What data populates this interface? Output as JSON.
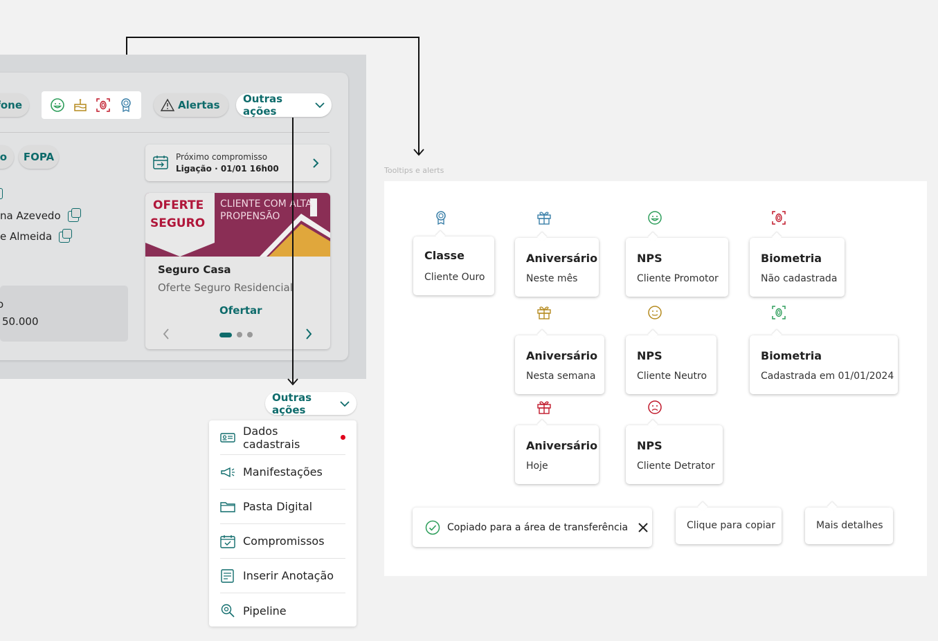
{
  "toolbar": {
    "phone_label": "fone",
    "alerts_label": "Alertas",
    "outras_acoes_label": "Outras ações"
  },
  "tags": [
    "o",
    "FOPA"
  ],
  "left_rows": {
    "row1": "na Azevedo",
    "row2": "e Almeida",
    "box_line1": "o",
    "box_line2": "50.000"
  },
  "appointment": {
    "title": "Próximo compromisso",
    "detail": "Ligação · 01/01 16h00"
  },
  "promo": {
    "banner_left1": "OFERTE",
    "banner_left2": "SEGURO",
    "banner_right1": "CLIENTE COM ALTA",
    "banner_right2": "PROPENSÃO",
    "title": "Seguro Casa",
    "subtitle": "Oferte Seguro Residencial",
    "cta": "Ofertar",
    "pager_count": 3,
    "pager_active": 1
  },
  "dropdown": {
    "button_label": "Outras ações",
    "items": [
      {
        "label": "Dados cadastrais",
        "icon": "id-card-icon",
        "dot": true
      },
      {
        "label": "Manifestações",
        "icon": "megaphone-icon"
      },
      {
        "label": "Pasta Digital",
        "icon": "folder-icon"
      },
      {
        "label": "Compromissos",
        "icon": "calendar-check-icon"
      },
      {
        "label": "Inserir Anotação",
        "icon": "note-icon"
      },
      {
        "label": "Pipeline",
        "icon": "pipeline-icon"
      }
    ]
  },
  "panel": {
    "caption": "Tooltips e alerts",
    "tooltips": {
      "classe": {
        "title": "Classe",
        "sub": "Cliente Ouro"
      },
      "aniv1": {
        "title": "Aniversário",
        "sub": "Neste mês"
      },
      "aniv2": {
        "title": "Aniversário",
        "sub": "Nesta semana"
      },
      "aniv3": {
        "title": "Aniversário",
        "sub": "Hoje"
      },
      "nps1": {
        "title": "NPS",
        "sub": "Cliente Promotor"
      },
      "nps2": {
        "title": "NPS",
        "sub": "Cliente Neutro"
      },
      "nps3": {
        "title": "NPS",
        "sub": "Cliente Detrator"
      },
      "bio1": {
        "title": "Biometria",
        "sub": "Não cadastrada"
      },
      "bio2": {
        "title": "Biometria",
        "sub": "Cadastrada em 01/01/2024"
      }
    },
    "toast": "Copiado para a área de transferência",
    "copy_tip": "Clique para copiar",
    "details_tip": "Mais detalhes"
  },
  "colors": {
    "teal": "#0e6b6b",
    "green": "#2e9e5b",
    "gold": "#b58a1e",
    "red": "#c0182a",
    "blue": "#3a7fa8",
    "banner": "#8a2e55",
    "alert_dot": "#e0001b"
  }
}
